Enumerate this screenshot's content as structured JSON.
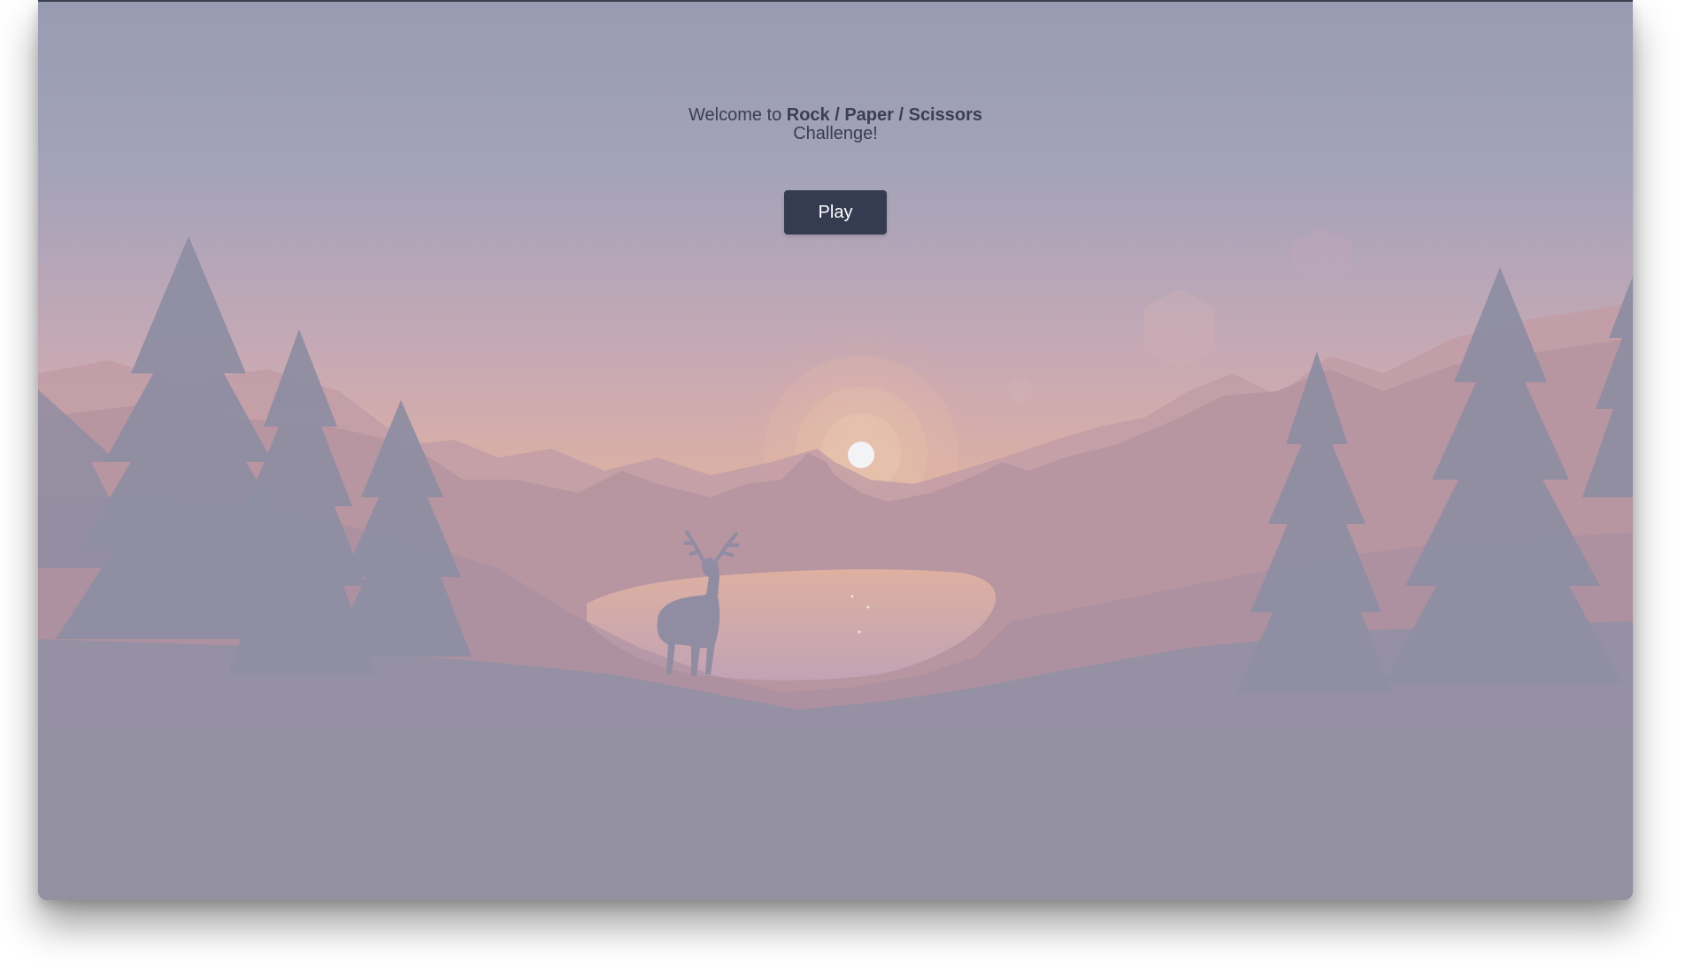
{
  "welcome": {
    "prefix": "Welcome to ",
    "game_name": "Rock / Paper / Scissors",
    "line2": "Challenge!"
  },
  "play_button": {
    "label": "Play"
  },
  "colors": {
    "button_bg": "#353c52",
    "text": "#3a3f52",
    "sky_top": "#9aa0b5",
    "sky_horizon": "#e8b89c",
    "sun": "#ffffff"
  }
}
